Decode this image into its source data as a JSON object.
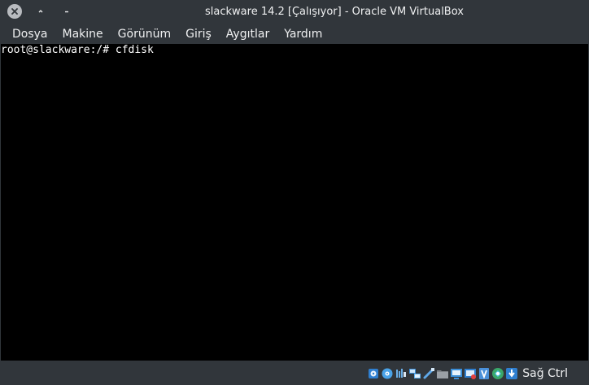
{
  "window": {
    "title": "slackware 14.2 [Çalışıyor] - Oracle VM VirtualBox"
  },
  "menubar": {
    "items": [
      {
        "label": "Dosya"
      },
      {
        "label": "Makine"
      },
      {
        "label": "Görünüm"
      },
      {
        "label": "Giriş"
      },
      {
        "label": "Aygıtlar"
      },
      {
        "label": "Yardım"
      }
    ]
  },
  "console": {
    "line1": "root@slackware:/# cfdisk"
  },
  "statusbar": {
    "icons": [
      "hard-disk-icon",
      "optical-drive-icon",
      "audio-icon",
      "network-icon",
      "usb-icon",
      "shared-folders-icon",
      "display-icon",
      "video-capture-icon",
      "virtualization-icon",
      "mouse-integration-icon",
      "keyboard-capture-icon"
    ],
    "host_key": "Sağ Ctrl"
  },
  "colors": {
    "window_bg": "#31363b",
    "text": "#eff0f1",
    "console_bg": "#000000",
    "console_text": "#ffffff"
  }
}
